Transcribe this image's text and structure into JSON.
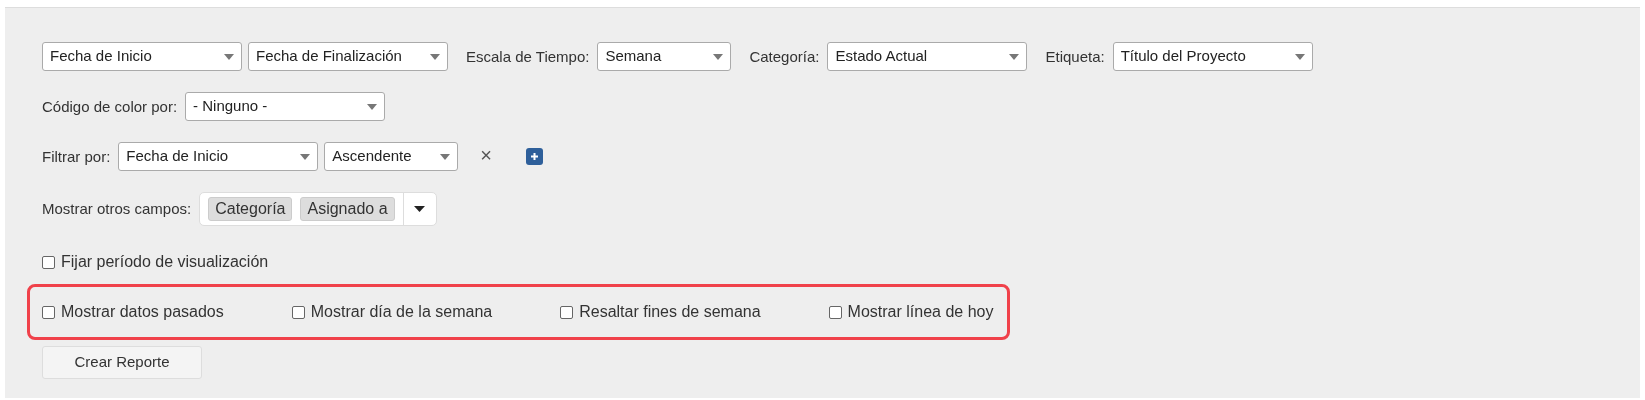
{
  "rows": [
    {
      "items": [
        {
          "kind": "select",
          "value": "Fecha de Inicio"
        },
        {
          "kind": "select",
          "value": "Fecha de Finalización"
        },
        {
          "kind": "label",
          "text": "Escala de Tiempo:"
        },
        {
          "kind": "select",
          "value": "Semana"
        },
        {
          "kind": "label",
          "text": "Categoría:"
        },
        {
          "kind": "select",
          "value": "Estado Actual"
        },
        {
          "kind": "label",
          "text": "Etiqueta:"
        },
        {
          "kind": "select",
          "value": "Título del Proyecto"
        }
      ]
    },
    {
      "items": [
        {
          "kind": "label",
          "text": "Código de color por:"
        },
        {
          "kind": "select",
          "value": "- Ninguno -"
        }
      ]
    },
    {
      "items": [
        {
          "kind": "label",
          "text": "Filtrar por:"
        },
        {
          "kind": "select",
          "value": "Fecha de Inicio"
        },
        {
          "kind": "select",
          "value": "Ascendente"
        },
        {
          "kind": "remove",
          "text": "×"
        },
        {
          "kind": "add"
        }
      ]
    },
    {
      "items": [
        {
          "kind": "label",
          "text": "Mostrar otros campos:"
        },
        {
          "kind": "tags",
          "tags": [
            "Categoría",
            "Asignado a"
          ]
        }
      ]
    }
  ],
  "lock_period": {
    "label": "Fijar período de visualización",
    "checked": false
  },
  "options": [
    {
      "label": "Mostrar datos pasados",
      "checked": false
    },
    {
      "label": "Mostrar día de la semana",
      "checked": false
    },
    {
      "label": "Resaltar fines de semana",
      "checked": false
    },
    {
      "label": "Mostrar línea de hoy",
      "checked": false
    }
  ],
  "submit": "Crear Reporte"
}
